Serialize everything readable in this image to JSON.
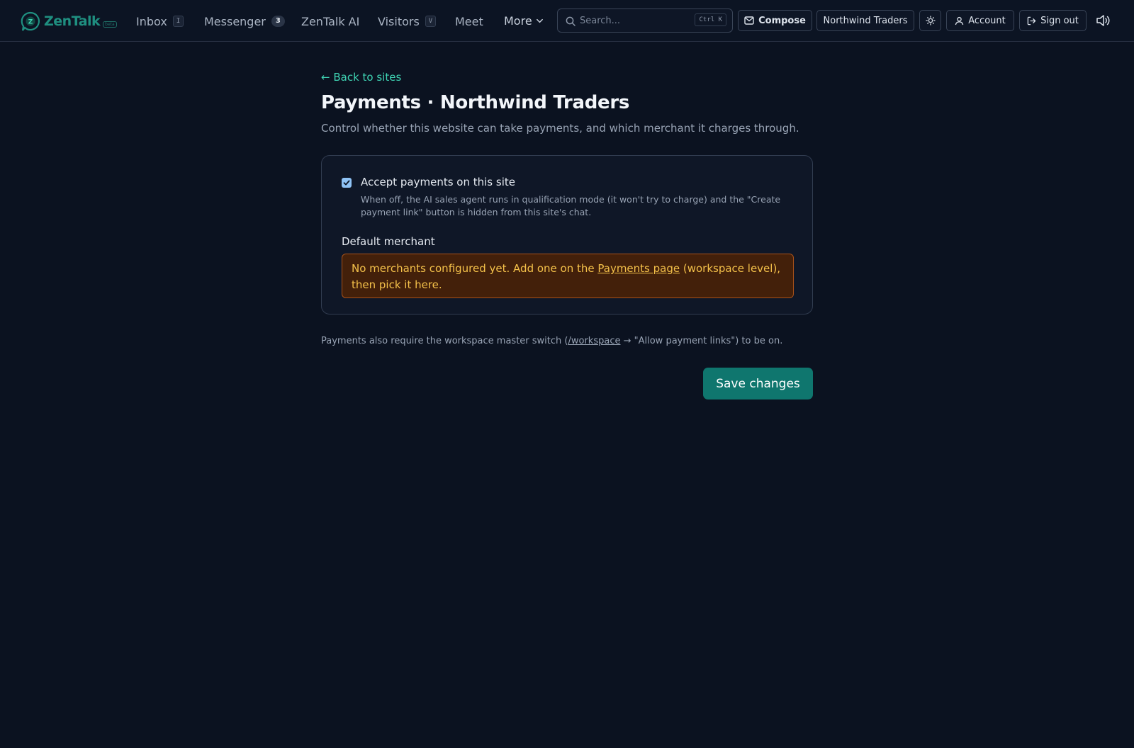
{
  "brand": {
    "name": "ZenTalk",
    "tag": "beta"
  },
  "nav": {
    "inbox": {
      "label": "Inbox",
      "shortcut": "I"
    },
    "messenger": {
      "label": "Messenger",
      "count": "3"
    },
    "ai": {
      "label": "ZenTalk AI"
    },
    "visitors": {
      "label": "Visitors",
      "shortcut": "V"
    },
    "meet": {
      "label": "Meet"
    },
    "more": {
      "label": "More"
    }
  },
  "search": {
    "placeholder": "Search...",
    "value": "",
    "shortcut": "Ctrl K"
  },
  "header_actions": {
    "compose": "Compose",
    "site": "Northwind Traders",
    "account": "Account",
    "sign_out": "Sign out"
  },
  "page": {
    "back_link": "← Back to sites",
    "title": "Payments · Northwind Traders",
    "subtitle": "Control whether this website can take payments, and which merchant it charges through."
  },
  "settings": {
    "accept_payments": {
      "label": "Accept payments on this site",
      "checked": true,
      "help": "When off, the AI sales agent runs in qualification mode (it won't try to charge) and the \"Create payment link\" button is hidden from this site's chat."
    },
    "default_merchant": {
      "label": "Default merchant",
      "warning_before": "No merchants configured yet. Add one on the ",
      "warning_link": "Payments page",
      "warning_after": " (workspace level), then pick it here."
    }
  },
  "footnote": {
    "before": "Payments also require the workspace master switch (",
    "link": "/workspace",
    "after": " → \"Allow payment links\") to be on."
  },
  "save_label": "Save changes",
  "colors": {
    "background": "#0b1220",
    "accent": "#0f766e",
    "link": "#3fd3b3",
    "warning_bg": "#43200a",
    "warning_text": "#f4c14a"
  }
}
